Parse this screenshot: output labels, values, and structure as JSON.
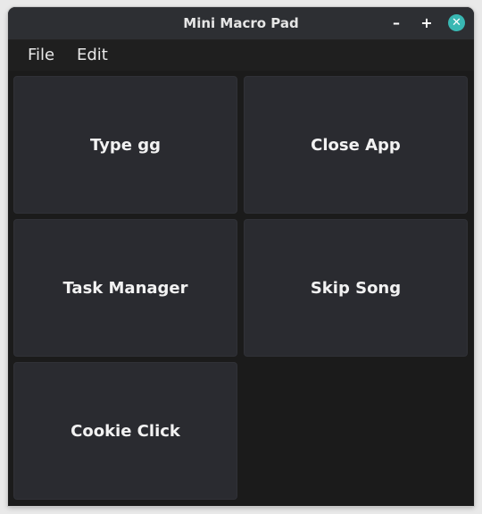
{
  "window": {
    "title": "Mini Macro Pad",
    "minimize_label": "–",
    "maximize_label": "+",
    "close_label": "✕",
    "accent_color": "#39b8b3"
  },
  "menubar": {
    "items": [
      {
        "label": "File"
      },
      {
        "label": "Edit"
      }
    ]
  },
  "macros": [
    {
      "label": "Type gg"
    },
    {
      "label": "Close App"
    },
    {
      "label": "Task Manager"
    },
    {
      "label": "Skip Song"
    },
    {
      "label": "Cookie Click"
    }
  ]
}
